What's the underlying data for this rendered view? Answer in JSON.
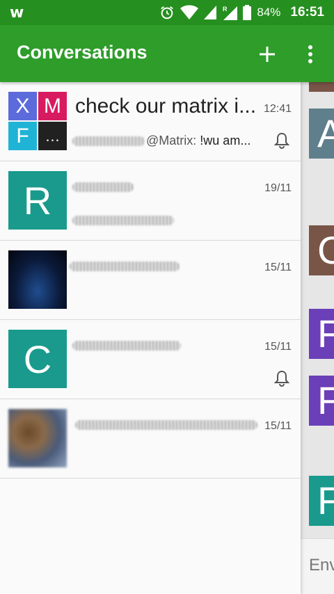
{
  "status_bar": {
    "app_logo": "w",
    "battery": "84%",
    "time": "16:51",
    "icons": [
      "alarm-icon",
      "wifi-icon",
      "signal-icon",
      "roaming-signal-icon",
      "battery-icon"
    ]
  },
  "app_bar": {
    "title": "Conversations",
    "add_icon": "plus-icon",
    "menu_icon": "overflow-menu-icon"
  },
  "conversations": [
    {
      "avatar_tiles": [
        {
          "letter": "X",
          "color": "#5c6bdb"
        },
        {
          "letter": "M",
          "color": "#d81b60"
        },
        {
          "letter": "F",
          "color": "#1fb4d6"
        },
        {
          "letter": "…",
          "color": "#212121"
        }
      ],
      "title": "check our matrix i...",
      "time": "12:41",
      "sender": "@Matrix:",
      "message": "!wu am...",
      "muted": true
    },
    {
      "avatar_letter": "R",
      "time": "19/11"
    },
    {
      "avatar_type": "photo",
      "time": "15/11"
    },
    {
      "avatar_letter": "C",
      "time": "15/11",
      "muted": true
    },
    {
      "avatar_type": "photo",
      "time": "15/11"
    }
  ],
  "background_pane": {
    "avatars": [
      {
        "letter": "A",
        "color": "#5f7f8c"
      },
      {
        "letter": "C",
        "color": "#795548"
      },
      {
        "letter": "F",
        "color": "#6a3fb7"
      },
      {
        "letter": "F",
        "color": "#6a3fb7"
      },
      {
        "letter": "F",
        "color": "#199a8c"
      }
    ],
    "input_hint": "Env"
  },
  "colors": {
    "status_bar": "#258f1f",
    "app_bar": "#2e9d2a",
    "teal_avatar": "#199a8c"
  }
}
